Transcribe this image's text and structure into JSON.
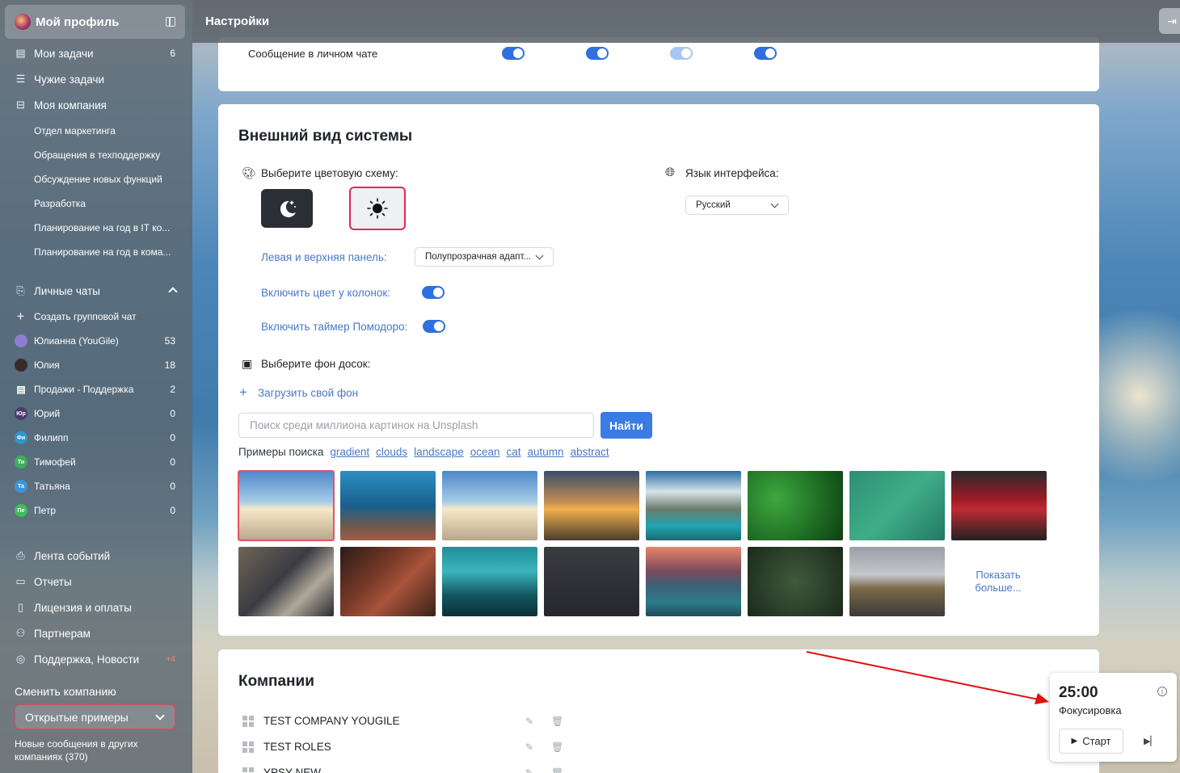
{
  "header": {
    "title": "Настройки"
  },
  "sidebar": {
    "profile": {
      "title": "Мой профиль"
    },
    "main_items": [
      {
        "label": "Мои задачи",
        "count": "6",
        "icon": "tasks-icon"
      },
      {
        "label": "Чужие задачи",
        "count": "",
        "icon": "list-icon"
      },
      {
        "label": "Моя компания",
        "count": "",
        "icon": "briefcase-icon"
      }
    ],
    "projects": [
      "Отдел маркетинга",
      "Обращения в техподдержку",
      "Обсуждение новых функций",
      "Разработка",
      "Планирование на год в IT ко...",
      "Планирование на год в кома..."
    ],
    "chats_header": "Личные чаты",
    "create_group": "Создать групповой чат",
    "chats": [
      {
        "name": "Юлианна (YouGile)",
        "count": "53",
        "avatar": "",
        "color": "#8c7fd0"
      },
      {
        "name": "Юлия",
        "count": "18",
        "avatar": "",
        "color": "#3a2a2a"
      },
      {
        "name": "Продажи - Поддержка",
        "count": "2",
        "avatar": "",
        "color": ""
      },
      {
        "name": "Юрий",
        "count": "0",
        "avatar": "Юр",
        "color": "#4b3a6e"
      },
      {
        "name": "Филипп",
        "count": "0",
        "avatar": "Фи",
        "color": "#2f97c9"
      },
      {
        "name": "Тимофей",
        "count": "0",
        "avatar": "Ти",
        "color": "#3fae5a"
      },
      {
        "name": "Татьяна",
        "count": "0",
        "avatar": "Та",
        "color": "#3f94d8"
      },
      {
        "name": "Петр",
        "count": "0",
        "avatar": "Пе",
        "color": "#3fbf5a"
      }
    ],
    "bottom_items": [
      {
        "label": "Лента событий",
        "count": ""
      },
      {
        "label": "Отчеты",
        "count": ""
      },
      {
        "label": "Лицензия и оплаты",
        "count": ""
      },
      {
        "label": "Партнерам",
        "count": ""
      },
      {
        "label": "Поддержка, Новости",
        "count": "+4"
      }
    ],
    "change_company": "Сменить компанию",
    "company_select": "Открытые примеры",
    "new_messages": "Новые сообщения в других компаниях (370)"
  },
  "notifications": {
    "row_label": "Сообщение в личном чате",
    "toggles": [
      true,
      true,
      true,
      true
    ]
  },
  "appearance": {
    "title": "Внешний вид системы",
    "color_scheme_label": "Выберите цветовую схему:",
    "language_label": "Язык интерфейса:",
    "language_value": "Русский",
    "panel_label": "Левая и верхняя панель:",
    "panel_value": "Полупрозрачная адапт...",
    "column_color_label": "Включить цвет у колонок:",
    "pomodoro_label": "Включить таймер Помодоро:",
    "background_label": "Выберите фон досок:",
    "upload_label": "Загрузить свой фон",
    "search_placeholder": "Поиск среди миллиона картинок на Unsplash",
    "search_button": "Найти",
    "examples_label": "Примеры поиска",
    "examples": [
      "gradient",
      "clouds",
      "landscape",
      "ocean",
      "cat",
      "autumn",
      "abstract"
    ],
    "show_more": "Показать больше..."
  },
  "companies": {
    "title": "Компании",
    "items": [
      "TEST COMPANY YOUGILE",
      "TEST ROLES",
      "YPSY NEW"
    ]
  },
  "pomodoro": {
    "time": "25:00",
    "mode": "Фокусировка",
    "start": "Старт"
  },
  "colors": {
    "accent": "#3a7ce3",
    "selected": "#e0275f",
    "arrow": "#e01010"
  }
}
